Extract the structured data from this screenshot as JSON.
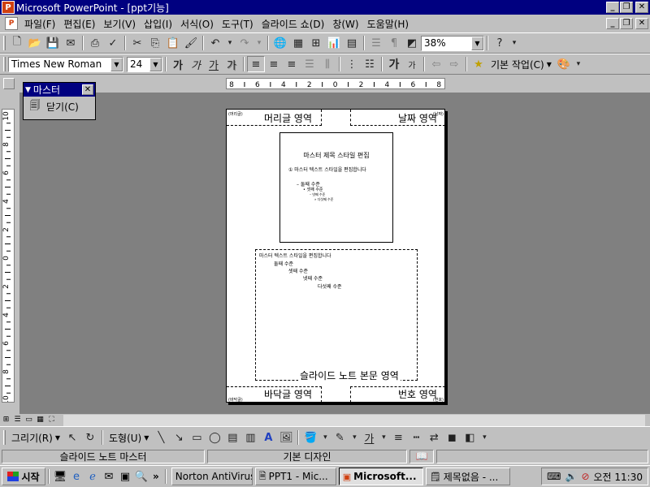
{
  "window": {
    "title": "Microsoft PowerPoint - [ppt기능]",
    "app_icon_letter": "P"
  },
  "menu": {
    "items": [
      "파일(F)",
      "편집(E)",
      "보기(V)",
      "삽입(I)",
      "서식(O)",
      "도구(T)",
      "슬라이드 쇼(D)",
      "창(W)",
      "도움말(H)"
    ]
  },
  "toolbar": {
    "zoom_value": "38%",
    "font_name": "Times New Roman",
    "font_size": "24",
    "bold_label": "가",
    "italic_label": "가",
    "underline_label": "가",
    "shadow_label": "가",
    "grow_font_label": "가",
    "shrink_font_label": "가",
    "common_tasks_label": "기본 작업(C)"
  },
  "ruler": {
    "h_marks": [
      "8",
      "6",
      "4",
      "2",
      "0",
      "2",
      "4",
      "6",
      "8"
    ],
    "v_marks": [
      "10",
      "8",
      "6",
      "4",
      "2",
      "0",
      "2",
      "4",
      "6",
      "8",
      "10"
    ]
  },
  "master_toolbar": {
    "title": "마스터",
    "close_label": "닫기(C)"
  },
  "notes_page": {
    "header_area": "머리글 영역",
    "date_area": "날짜 영역",
    "footer_area": "바닥글 영역",
    "number_area": "번호 영역",
    "body_area": "슬라이드 노트 본문 영역",
    "header_tiny": "(머리글)",
    "date_tiny": "(날짜)",
    "footer_tiny": "(바닥글)",
    "number_tiny": "(번호)",
    "slide_title": "마스터 제목 스타일 편집",
    "slide_text": "① 마스터 텍스트 스타일을 편집합니다",
    "slide_level2": "– 둘째 수준",
    "slide_level3": "• 셋째 수준",
    "slide_level4": "– 넷째 수준",
    "slide_level5": "» 다섯째 수준",
    "notes_text": "마스터 텍스트 스타일을 편집합니다",
    "notes_level2": "둘째 수준",
    "notes_level3": "셋째 수준",
    "notes_level4": "넷째 수준",
    "notes_level5": "다섯째 수준"
  },
  "drawing_toolbar": {
    "draw_label": "그리기(R)",
    "autoshapes_label": "도형(U)"
  },
  "status": {
    "view_name": "슬라이드 노트 마스터",
    "design_name": "기본 디자인"
  },
  "taskbar": {
    "start_label": "시작",
    "chevron": "»",
    "buttons": [
      "Norton AntiVirus",
      "PPT1 - Mic...",
      "Microsoft...",
      "제목없음 - ..."
    ],
    "clock": "오전 11:30"
  },
  "colors": {
    "titlebar": "#000080",
    "workspace": "#808080",
    "face": "#c0c0c0"
  }
}
